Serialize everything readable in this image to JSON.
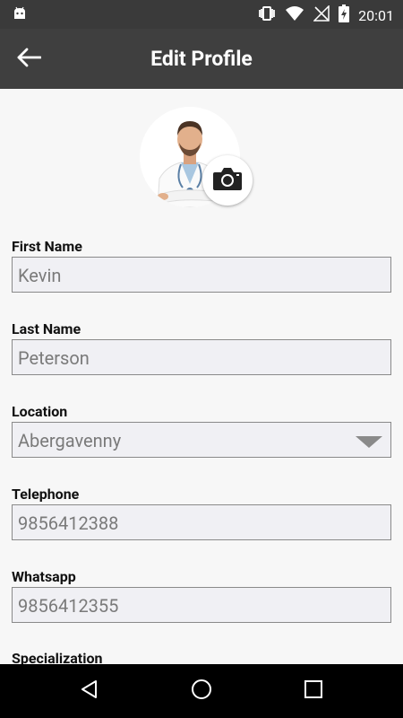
{
  "status": {
    "time": "20:01",
    "left_icon": "android-icon",
    "right_icons": [
      "vibrate-icon",
      "wifi-icon",
      "no-signal-icon",
      "battery-charging-icon"
    ]
  },
  "header": {
    "title": "Edit Profile",
    "back_icon": "arrow-left-icon"
  },
  "profile": {
    "avatar": "doctor-avatar",
    "camera_icon": "camera-icon"
  },
  "form": {
    "first_name": {
      "label": "First Name",
      "value": "Kevin"
    },
    "last_name": {
      "label": "Last Name",
      "value": "Peterson"
    },
    "location": {
      "label": "Location",
      "value": "Abergavenny"
    },
    "telephone": {
      "label": "Telephone",
      "value": "9856412388"
    },
    "whatsapp": {
      "label": "Whatsapp",
      "value": "9856412355"
    },
    "specialization": {
      "label": "Specialization"
    }
  },
  "nav": [
    "back-triangle-icon",
    "home-circle-icon",
    "recents-square-icon"
  ]
}
